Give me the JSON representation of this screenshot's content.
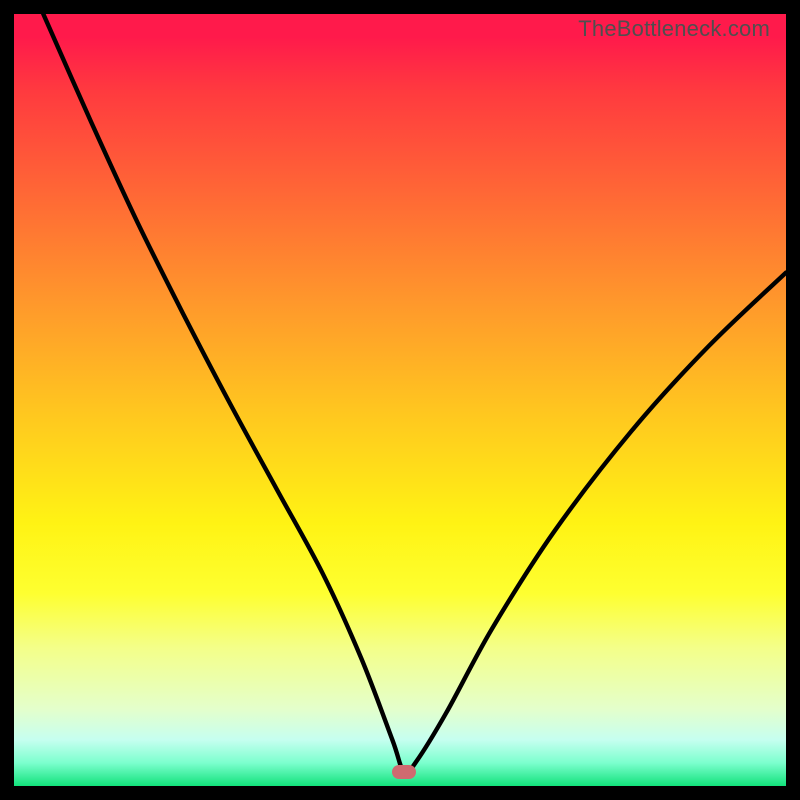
{
  "attribution": "TheBottleneck.com",
  "colors": {
    "frame": "#000000",
    "gradient_top": "#ff1a4b",
    "gradient_bottom": "#12e27b",
    "curve": "#000000",
    "marker": "#cf6a70",
    "attribution_text": "#4f4f4f"
  },
  "marker": {
    "x_frac": 0.505,
    "y_frac": 0.982
  },
  "chart_data": {
    "type": "line",
    "title": "",
    "xlabel": "",
    "ylabel": "",
    "legend": false,
    "grid": false,
    "xlim": [
      0,
      1
    ],
    "ylim": [
      0,
      1
    ],
    "series": [
      {
        "name": "bottleneck-curve",
        "x": [
          0.038,
          0.1,
          0.16,
          0.22,
          0.28,
          0.34,
          0.4,
          0.45,
          0.49,
          0.505,
          0.52,
          0.56,
          0.62,
          0.7,
          0.8,
          0.9,
          1.0
        ],
        "y": [
          1.0,
          0.86,
          0.73,
          0.61,
          0.495,
          0.385,
          0.275,
          0.165,
          0.06,
          0.018,
          0.03,
          0.095,
          0.205,
          0.33,
          0.46,
          0.57,
          0.665
        ]
      }
    ],
    "annotations": [
      {
        "type": "marker",
        "x": 0.505,
        "y": 0.018,
        "shape": "pill",
        "color": "#cf6a70"
      }
    ]
  }
}
